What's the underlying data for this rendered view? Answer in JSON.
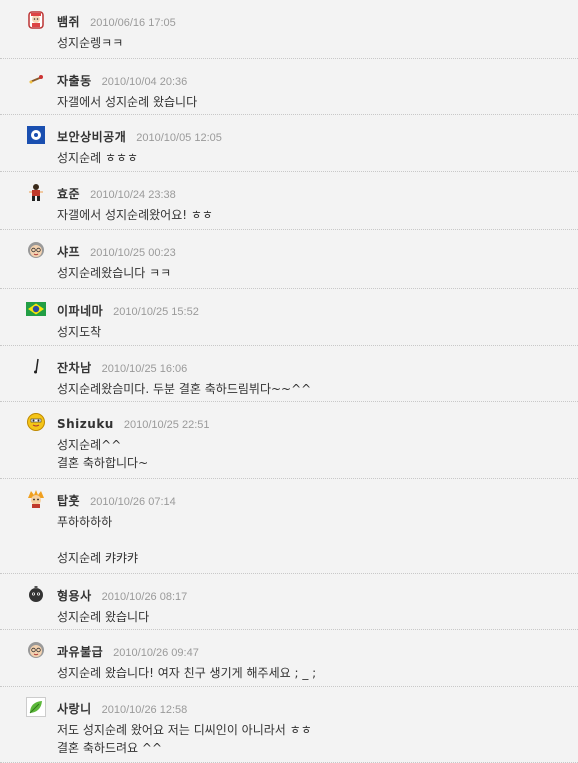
{
  "comments": [
    {
      "avatar": "girl-avatar-icon",
      "nick": "뱀쥐",
      "date": "2010/06/16 17:05",
      "text": "성지순렝ㅋㅋ"
    },
    {
      "avatar": "tiny-figure-avatar-icon",
      "nick": "자출동",
      "date": "2010/10/04 20:36",
      "text": "자갤에서 성지순례 왔습니다"
    },
    {
      "avatar": "blue-badge-avatar-icon",
      "nick": "보안상비공개",
      "date": "2010/10/05 12:05",
      "text": "성지순례 ㅎㅎㅎ"
    },
    {
      "avatar": "fighter-avatar-icon",
      "nick": "효준",
      "date": "2010/10/24 23:38",
      "text": "자갤에서 성지순례왔어요! ㅎㅎ"
    },
    {
      "avatar": "gray-hair-face-avatar-icon",
      "nick": "샤프",
      "date": "2010/10/25 00:23",
      "text": "성지순례왔습니다 ㅋㅋ"
    },
    {
      "avatar": "brazil-flag-avatar-icon",
      "nick": "이파네마",
      "date": "2010/10/25 15:52",
      "text": "성지도착"
    },
    {
      "avatar": "stick-avatar-icon",
      "nick": "잔차남",
      "date": "2010/10/25 16:06",
      "text": "성지순례왔슴미다. 두분 결혼 축하드림뷔다~~^^"
    },
    {
      "avatar": "yellow-face-avatar-icon",
      "nick": "Shizuku",
      "date": "2010/10/25 22:51",
      "text": "성지순례^^\n결혼 축하합니다~"
    },
    {
      "avatar": "spiky-hair-avatar-icon",
      "nick": "탑훗",
      "date": "2010/10/26 07:14",
      "text": "푸하하하하\n\n성지순례 캬캬캬"
    },
    {
      "avatar": "bomb-avatar-icon",
      "nick": "형용사",
      "date": "2010/10/26 08:17",
      "text": "성지순례 왔습니다"
    },
    {
      "avatar": "gray-hair-face-avatar-icon",
      "nick": "과유불급",
      "date": "2010/10/26 09:47",
      "text": "성지순례 왔습니다! 여자 친구 생기게 해주세요 ; _ ;"
    },
    {
      "avatar": "leaf-avatar-icon",
      "nick": "사랑니",
      "date": "2010/10/26 12:58",
      "text": "저도 성지순례 왔어요 저는 디씨인이 아니라서 ㅎㅎ\n결혼 축하드려요 ^^"
    }
  ]
}
